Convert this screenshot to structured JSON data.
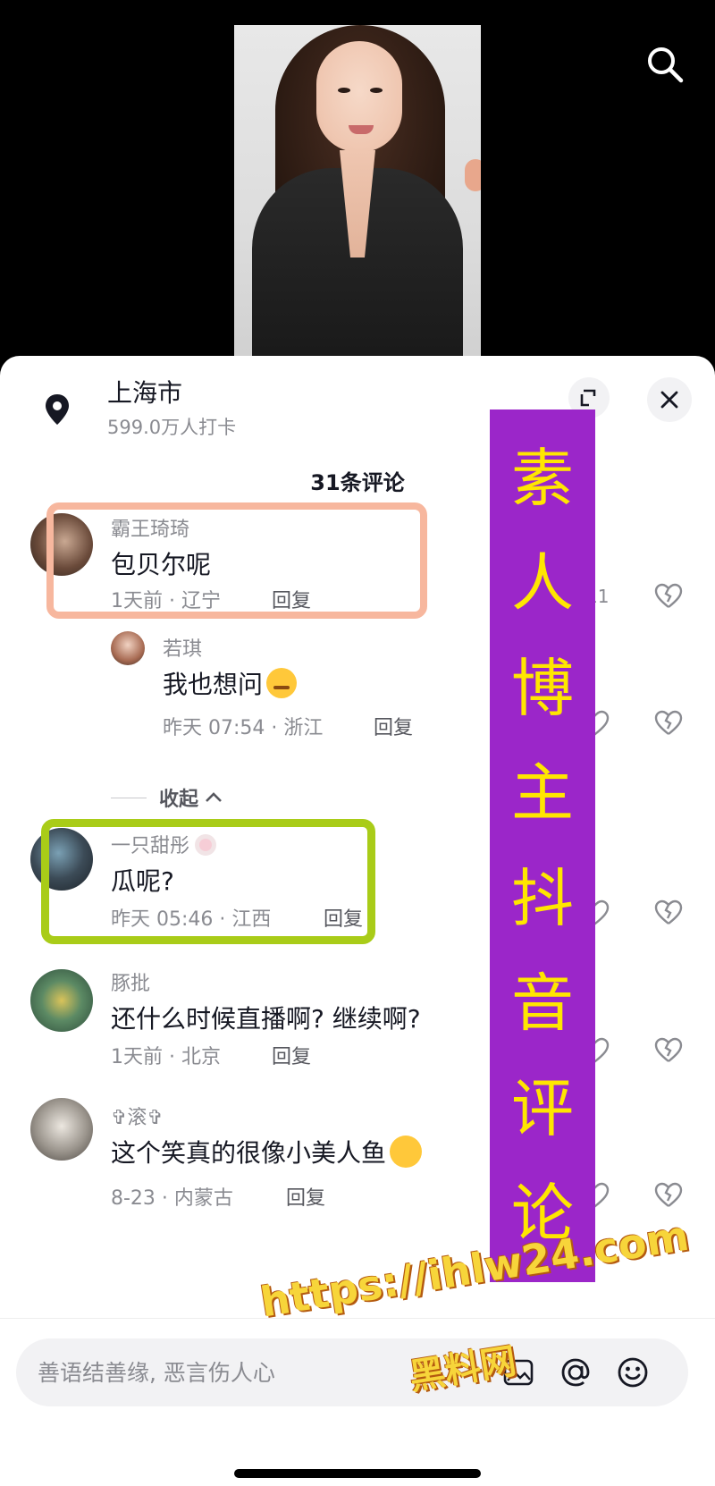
{
  "location": {
    "title": "上海市",
    "checkins": "599.0万人打卡"
  },
  "comment_count": "31条评论",
  "comments": [
    {
      "user": "霸王琦琦",
      "text": "包贝尔呢",
      "time": "1天前 · 辽宁",
      "reply": "回复",
      "likes": "11"
    },
    {
      "user": "若琪",
      "text": "我也想问",
      "time": "昨天 07:54 · 浙江",
      "reply": "回复"
    },
    {
      "user": "一只甜彤",
      "text": "瓜呢?",
      "time": "昨天 05:46 · 江西",
      "reply": "回复"
    },
    {
      "user": "豚批",
      "text": "还什么时候直播啊? 继续啊?",
      "time": "1天前 · 北京",
      "reply": "回复"
    },
    {
      "user": "✞滚✞",
      "text": "这个笑真的很像小美人鱼",
      "time": "8-23 · 内蒙古",
      "reply": "回复"
    }
  ],
  "collapse_label": "收起",
  "banner": [
    "素",
    "人",
    "博",
    "主",
    "抖",
    "音",
    "评",
    "论"
  ],
  "watermark": {
    "url": "https://ihlw24.com",
    "name": "黑料网"
  },
  "input": {
    "placeholder": "善语结善缘, 恶言伤人心"
  },
  "colors": {
    "banner_bg": "#9b26c9",
    "banner_text": "#ffe600",
    "highlight_peach": "#f7b79e",
    "highlight_green": "#a9cc18"
  }
}
